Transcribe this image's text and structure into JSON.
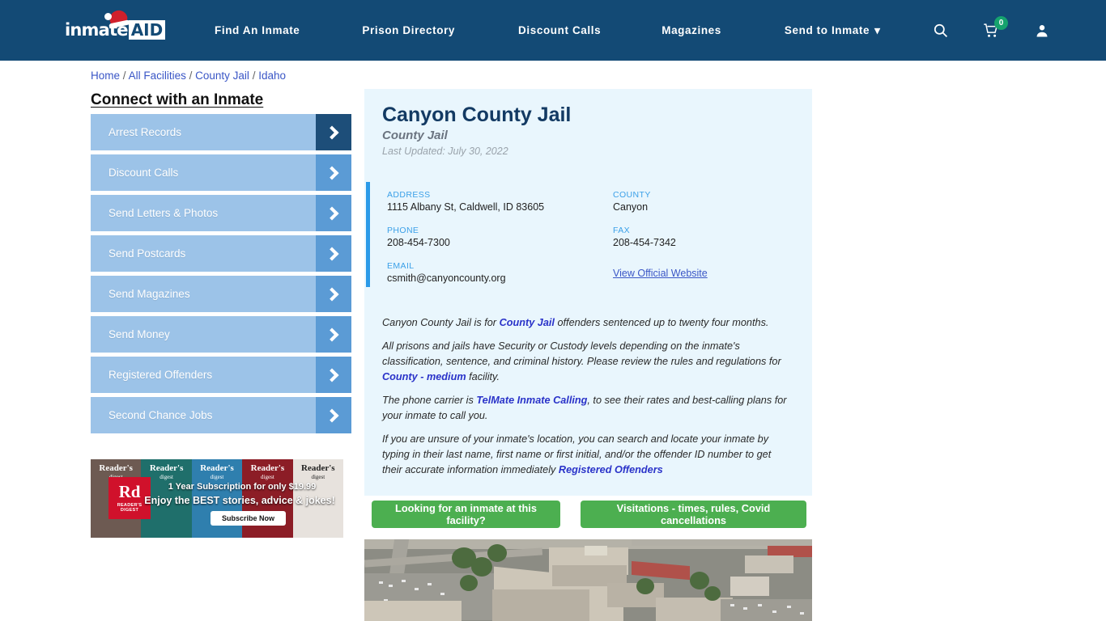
{
  "nav": {
    "logo": {
      "text": "inmate",
      "badge": "AID",
      "icon": "santa-hat-icon"
    },
    "links": [
      {
        "label": "Find An Inmate"
      },
      {
        "label": "Prison Directory"
      },
      {
        "label": "Discount Calls"
      },
      {
        "label": "Magazines"
      },
      {
        "label": "Send to Inmate",
        "has_dropdown": true,
        "caret": "▾"
      }
    ],
    "icons": {
      "search": "search-icon",
      "cart": "cart-icon",
      "cart_count": "0",
      "cart_badge_color": "#15a36e",
      "account": "user-icon"
    },
    "background": "#134a75"
  },
  "breadcrumb": {
    "items": [
      "Home",
      "All Facilities",
      "County Jail",
      "Idaho"
    ],
    "separator": "/"
  },
  "sidebar": {
    "title": "Connect with an Inmate",
    "items": [
      {
        "label": "Arrest Records",
        "active": true
      },
      {
        "label": "Discount Calls",
        "active": false
      },
      {
        "label": "Send Letters & Photos",
        "active": false
      },
      {
        "label": "Send Postcards",
        "active": false
      },
      {
        "label": "Send Magazines",
        "active": false
      },
      {
        "label": "Send Money",
        "active": false
      },
      {
        "label": "Registered Offenders",
        "active": false
      },
      {
        "label": "Second Chance Jobs",
        "active": false
      }
    ]
  },
  "ad": {
    "brand": "Rd",
    "brand_sub": "READER'S DIGEST",
    "line1": "1 Year Subscription for only $19.99",
    "line2": "Enjoy the BEST stories, advice & jokes!",
    "cta": "Subscribe Now",
    "covers": [
      {
        "title": "Reader's",
        "sub": "digest"
      },
      {
        "title": "Reader's",
        "sub": "digest"
      },
      {
        "title": "Reader's",
        "sub": "digest"
      },
      {
        "title": "Reader's",
        "sub": "digest"
      },
      {
        "title": "Reader's",
        "sub": "digest"
      }
    ]
  },
  "facility": {
    "name": "Canyon County Jail",
    "type": "County Jail",
    "last_updated": "Last Updated: July 30, 2022",
    "contact": {
      "address_label": "ADDRESS",
      "address_value": "1115 Albany St, Caldwell, ID 83605",
      "county_label": "COUNTY",
      "county_value": "Canyon",
      "phone_label": "PHONE",
      "phone_value": "208-454-7300",
      "fax_label": "FAX",
      "fax_value": "208-454-7342",
      "email_label": "EMAIL",
      "email_value": "csmith@canyoncounty.org",
      "website_link": "View Official Website"
    },
    "description": {
      "p1_a": "Canyon County Jail is for ",
      "p1_link": "County Jail",
      "p1_b": " offenders sentenced up to twenty four months.",
      "p2_a": "All prisons and jails have Security or Custody levels depending on the inmate's classification, sentence, and criminal history. Please review the rules and regulations for ",
      "p2_link": "County - medium",
      "p2_b": " facility.",
      "p3_a": "The phone carrier is ",
      "p3_link": "TelMate Inmate Calling",
      "p3_b": ", to see their rates and best-calling plans for your inmate to call you.",
      "p4_a": "If you are unsure of your inmate's location, you can search and locate your inmate by typing in their last name, first name or first initial, and/or the offender ID number to get their accurate information immediately ",
      "p4_link": "Registered Offenders"
    }
  },
  "actions": {
    "find_inmate": "Looking for an inmate at this facility?",
    "visitations": "Visitations - times, rules, Covid cancellations",
    "button_color": "#4caf50"
  },
  "aerial_photo": {
    "alt": "Aerial view of Canyon County Jail complex"
  },
  "colors": {
    "navbar": "#134a75",
    "card": "#e9f6fd",
    "accent": "#2b9ae8",
    "link": "#3a56c6",
    "sidebar_item": "#9cc3e8",
    "sidebar_arrow": "#5b9bd5",
    "sidebar_arrow_active": "#1d4e79"
  }
}
